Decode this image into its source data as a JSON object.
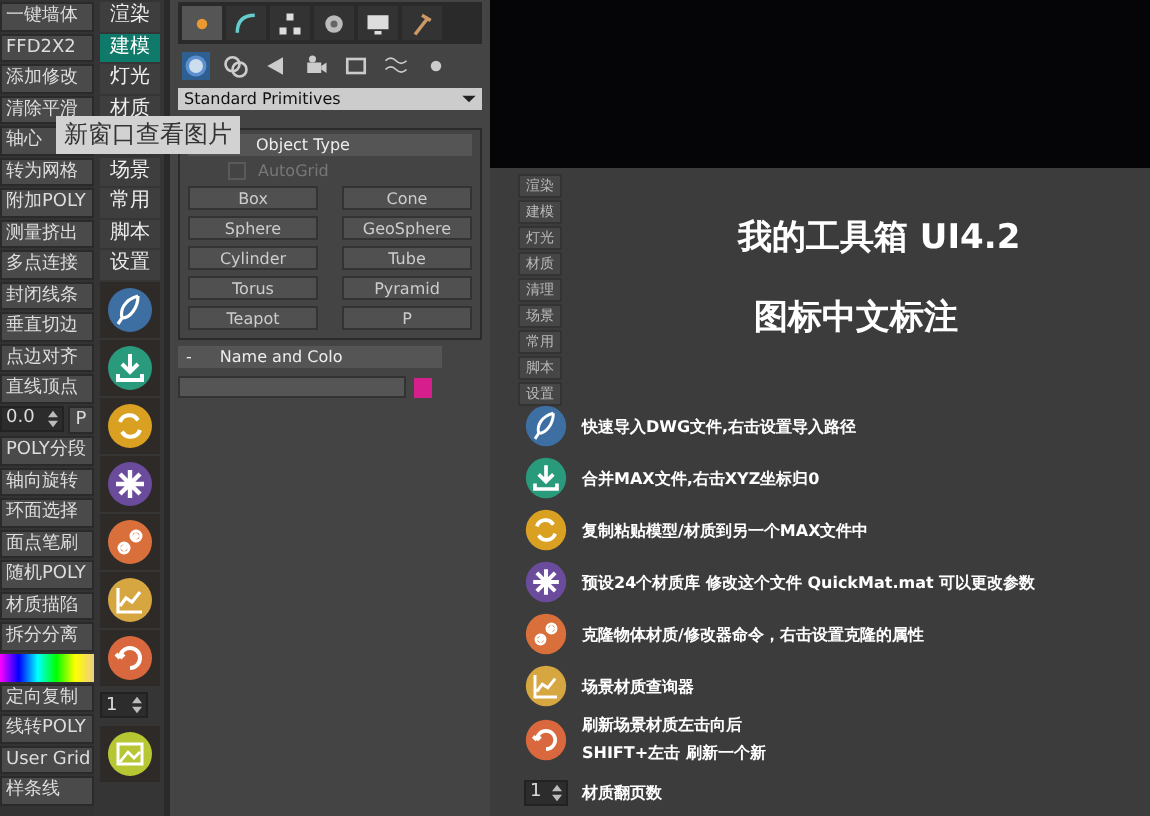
{
  "tooltip": "新窗口查看图片",
  "left_buttons": [
    {
      "kind": "button",
      "label": "一键墙体"
    },
    {
      "kind": "button",
      "label": "FFD2X2"
    },
    {
      "kind": "button",
      "label": "添加修改"
    },
    {
      "kind": "button",
      "label": "清除平滑"
    },
    {
      "kind": "button",
      "label": "轴心"
    },
    {
      "kind": "button",
      "label": "转为网格"
    },
    {
      "kind": "button",
      "label": "附加POLY"
    },
    {
      "kind": "button",
      "label": "测量挤出"
    },
    {
      "kind": "button",
      "label": "多点连接"
    },
    {
      "kind": "button",
      "label": "封闭线条"
    },
    {
      "kind": "button",
      "label": "垂直切边"
    },
    {
      "kind": "button",
      "label": "点边对齐"
    },
    {
      "kind": "button",
      "label": "直线顶点"
    },
    {
      "kind": "spinner",
      "value": "0.0",
      "button": "P"
    },
    {
      "kind": "button",
      "label": "POLY分段"
    },
    {
      "kind": "button",
      "label": "轴向旋转"
    },
    {
      "kind": "button",
      "label": "环面选择"
    },
    {
      "kind": "button",
      "label": "面点笔刷"
    },
    {
      "kind": "button",
      "label": "随机POLY"
    },
    {
      "kind": "button",
      "label": "材质描陷"
    },
    {
      "kind": "button",
      "label": "拆分分离"
    },
    {
      "kind": "gradient"
    },
    {
      "kind": "button",
      "label": "定向复制"
    },
    {
      "kind": "button",
      "label": "线转POLY"
    },
    {
      "kind": "button",
      "label": "User Grid"
    },
    {
      "kind": "button",
      "label": "样条线"
    }
  ],
  "menu_tabs": [
    {
      "label": "渲染",
      "selected": false
    },
    {
      "label": "建模",
      "selected": true
    },
    {
      "label": "灯光",
      "selected": false
    },
    {
      "label": "材质",
      "selected": false
    },
    {
      "label": "场景",
      "selected": false
    },
    {
      "label": "常用",
      "selected": false
    },
    {
      "label": "脚本",
      "selected": false
    },
    {
      "label": "设置",
      "selected": false
    }
  ],
  "tools": [
    {
      "kind": "feather",
      "color": "#3d6fa3"
    },
    {
      "kind": "download",
      "color": "#2a9a7c"
    },
    {
      "kind": "arrows",
      "color": "#d9a022"
    },
    {
      "kind": "asterisk",
      "color": "#6b4c9c"
    },
    {
      "kind": "chain",
      "color": "#d9703c"
    },
    {
      "kind": "chart",
      "color": "#d6a640"
    },
    {
      "kind": "refresh",
      "color": "#d9683e"
    },
    {
      "kind": "spinner",
      "value": "1"
    },
    {
      "kind": "picture",
      "color": "#b7c734"
    }
  ],
  "command_tabs": [
    {
      "selected": true
    },
    {
      "selected": false
    },
    {
      "selected": false
    },
    {
      "selected": false
    },
    {
      "selected": false
    },
    {
      "selected": false
    }
  ],
  "dropdown": "Standard Primitives",
  "object_type": {
    "title": "Object Type",
    "autogrid": {
      "label": "AutoGrid",
      "checked": false
    },
    "buttons": [
      "Box",
      "Cone",
      "Sphere",
      "GeoSphere",
      "Cylinder",
      "Tube",
      "Torus",
      "Pyramid",
      "Teapot",
      "P"
    ]
  },
  "name_and_color": {
    "toggle": "-",
    "title": "Name and Colo",
    "color": "#d61f8c"
  },
  "help_panel": {
    "buttons": [
      "渲染",
      "建模",
      "灯光",
      "材质",
      "清理",
      "场景",
      "常用",
      "脚本",
      "设置"
    ],
    "title": "我的工具箱 UI4.2",
    "subtitle": "图标中文标注",
    "rows": [
      {
        "kind": "feather",
        "color": "#3d6fa3",
        "lines": [
          "快速导入DWG文件,右击设置导入路径"
        ]
      },
      {
        "kind": "download",
        "color": "#2a9a7c",
        "lines": [
          "合并MAX文件,右击XYZ坐标归0"
        ]
      },
      {
        "kind": "arrows",
        "color": "#d9a022",
        "lines": [
          "复制粘贴模型/材质到另一个MAX文件中"
        ]
      },
      {
        "kind": "asterisk",
        "color": "#6b4c9c",
        "lines": [
          "预设24个材质库  修改这个文件 QuickMat.mat 可以更改参数"
        ]
      },
      {
        "kind": "chain",
        "color": "#d9703c",
        "lines": [
          "克隆物体材质/修改器命令，右击设置克隆的属性"
        ]
      },
      {
        "kind": "chart",
        "color": "#d6a640",
        "lines": [
          "场景材质查询器"
        ]
      },
      {
        "kind": "refresh",
        "color": "#d9683e",
        "lines": [
          "刷新场景材质左击向后",
          "SHIFT+左击 刷新一个新"
        ]
      },
      {
        "kind": "spinner",
        "value": "1",
        "lines": [
          "材质翻页数"
        ]
      }
    ]
  }
}
